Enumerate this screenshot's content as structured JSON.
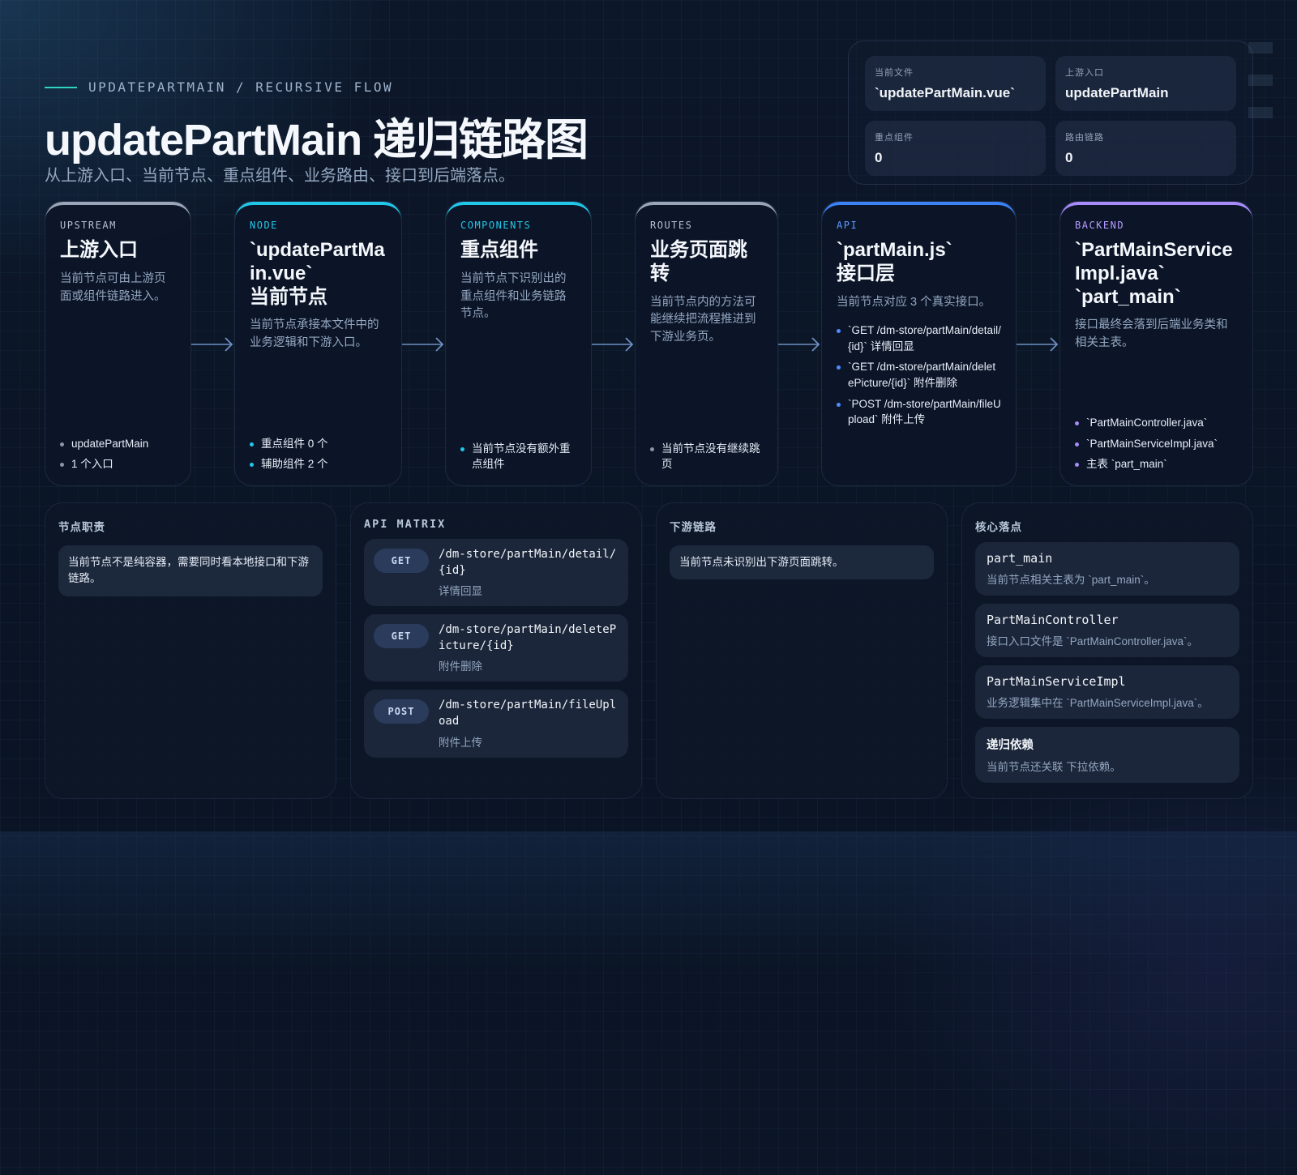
{
  "header": {
    "kicker": "UPDATEPARTMAIN / RECURSIVE FLOW",
    "title": "updatePartMain 递归链路图",
    "subtitle": "从上游入口、当前节点、重点组件、业务路由、接口到后端落点。"
  },
  "info": {
    "current_file_label": "当前文件",
    "current_file_value": "`updatePartMain.vue`",
    "upstream_label": "上游入口",
    "upstream_value": "updatePartMain",
    "components_label": "重点组件",
    "components_value": "0",
    "routes_label": "路由链路",
    "routes_value": "0"
  },
  "flow": {
    "upstream": {
      "tag": "UPSTREAM",
      "title": "上游入口",
      "desc": "当前节点可由上游页面或组件链路进入。",
      "items": [
        "updatePartMain",
        "1 个入口"
      ]
    },
    "node": {
      "tag": "NODE",
      "title": "`updatePartMain.vue`\n当前节点",
      "desc": "当前节点承接本文件中的业务逻辑和下游入口。",
      "items": [
        "重点组件 0 个",
        "辅助组件 2 个"
      ]
    },
    "components": {
      "tag": "COMPONENTS",
      "title": "重点组件",
      "desc": "当前节点下识别出的重点组件和业务链路节点。",
      "items": [
        "当前节点没有额外重点组件"
      ]
    },
    "routes": {
      "tag": "ROUTES",
      "title": "业务页面跳转",
      "desc": "当前节点内的方法可能继续把流程推进到下游业务页。",
      "items": [
        "当前节点没有继续跳页"
      ]
    },
    "api": {
      "tag": "API",
      "title": "`partMain.js`\n接口层",
      "desc": "当前节点对应 3 个真实接口。",
      "items": [
        "`GET /dm-store/partMain/detail/{id}` 详情回显",
        "`GET /dm-store/partMain/deletePicture/{id}` 附件删除",
        "`POST /dm-store/partMain/fileUpload` 附件上传"
      ]
    },
    "backend": {
      "tag": "BACKEND",
      "title": "`PartMainServiceImpl.java`\n`part_main`",
      "desc": "接口最终会落到后端业务类和相关主表。",
      "items": [
        "`PartMainController.java`",
        "`PartMainServiceImpl.java`",
        "主表 `part_main`"
      ]
    }
  },
  "panels": {
    "duty": {
      "title": "节点职责",
      "note": "当前节点不是纯容器，需要同时看本地接口和下游链路。"
    },
    "api_matrix": {
      "title": "API MATRIX",
      "rows": [
        {
          "method": "GET",
          "path": "/dm-store/partMain/detail/{id}",
          "desc": "详情回显"
        },
        {
          "method": "GET",
          "path": "/dm-store/partMain/deletePicture/{id}",
          "desc": "附件删除"
        },
        {
          "method": "POST",
          "path": "/dm-store/partMain/fileUpload",
          "desc": "附件上传"
        }
      ]
    },
    "downstream": {
      "title": "下游链路",
      "note": "当前节点未识别出下游页面跳转。"
    },
    "core": {
      "title": "核心落点",
      "items": [
        {
          "name": "part_main",
          "desc": "当前节点相关主表为 `part_main`。"
        },
        {
          "name": "PartMainController",
          "desc": "接口入口文件是 `PartMainController.java`。"
        },
        {
          "name": "PartMainServiceImpl",
          "desc": "业务逻辑集中在 `PartMainServiceImpl.java`。"
        },
        {
          "name": "递归依赖",
          "desc": "当前节点还关联 下拉依赖。"
        }
      ]
    }
  },
  "colors": {
    "upstream": "#9aa6b8",
    "node": "#22c7e8",
    "components": "#22c7e8",
    "routes": "#9aa6b8",
    "api": "#3b82f6",
    "backend": "#a78bfa"
  }
}
